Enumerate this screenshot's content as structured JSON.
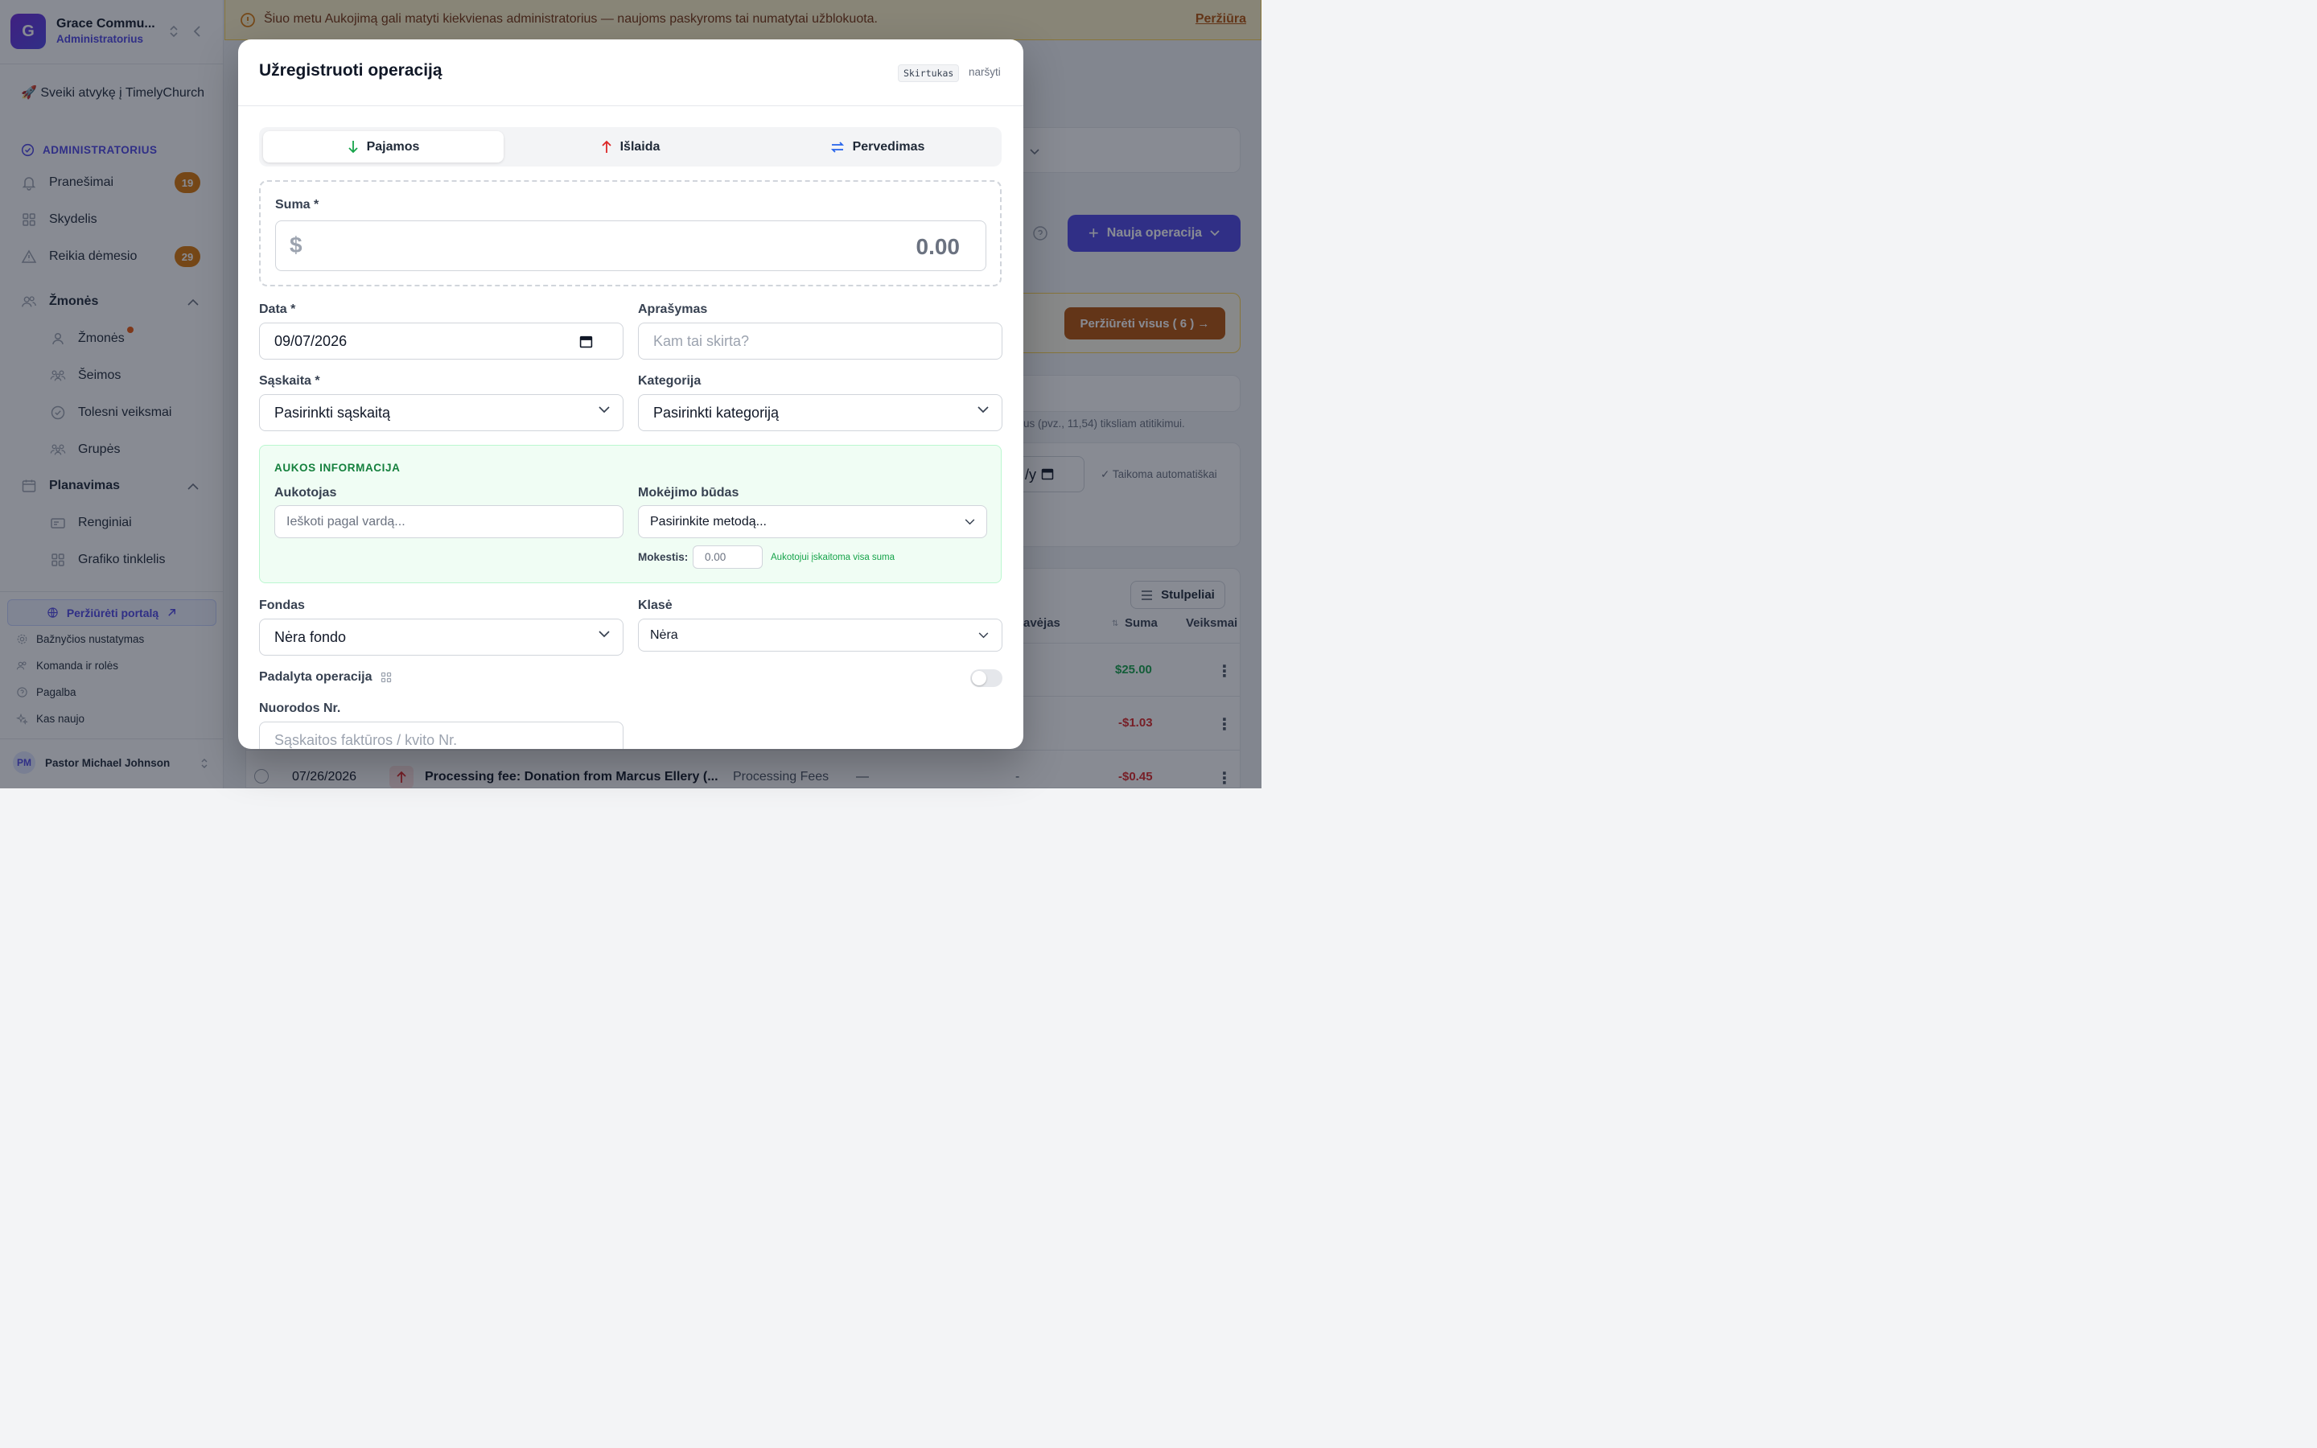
{
  "sidebar": {
    "org_initial": "G",
    "org_name": "Grace Commu...",
    "org_role": "Administratorius",
    "welcome": "🚀 Sveiki atvykę į TimelyChurch",
    "admin_label": "ADMINISTRATORIUS",
    "notifications": {
      "label": "Pranešimai",
      "count": "19"
    },
    "dashboard": {
      "label": "Skydelis"
    },
    "attention": {
      "label": "Reikia dėmesio",
      "count": "29"
    },
    "people_group": {
      "label": "Žmonės"
    },
    "people": {
      "label": "Žmonės"
    },
    "families": {
      "label": "Šeimos"
    },
    "followups": {
      "label": "Tolesni veiksmai"
    },
    "groups": {
      "label": "Grupės"
    },
    "planning_group": {
      "label": "Planavimas"
    },
    "events": {
      "label": "Renginiai"
    },
    "schedule_grid": {
      "label": "Grafiko tinklelis"
    },
    "portal_button": "Peržiūrėti portalą",
    "church_settings": "Bažnyčios nustatymas",
    "team_roles": "Komanda ir rolės",
    "help": "Pagalba",
    "whats_new": "Kas naujo",
    "user": {
      "initials": "PM",
      "name": "Pastor Michael Johnson"
    }
  },
  "banner": {
    "text": "Šiuo metu Aukojimą gali matyti kiekvienas administratorius — naujoms paskyroms tai numatytai užblokuota.",
    "link": "Peržiūra"
  },
  "background": {
    "new_operation": "Nauja operacija",
    "view_all": "Peržiūrėti visus ( 6 ) →",
    "hint_text": "us (pvz., 11,54) tiksliam atitikimui.",
    "date_placeholder": "/y",
    "applied_auto": "✓ Taikoma automatiškai",
    "columns_button": "Stulpeliai",
    "col_payer": "avėjas",
    "col_amount": "Suma",
    "col_actions": "Veiksmai",
    "rows": [
      {
        "amount": "$25.00"
      },
      {
        "amount": "-$1.03"
      },
      {
        "date": "07/26/2026",
        "description": "Processing fee: Donation from Marcus Ellery (...",
        "category": "Processing Fees",
        "payer": "—",
        "dash": "-",
        "amount": "-$0.45"
      }
    ]
  },
  "modal": {
    "title": "Užregistruoti operaciją",
    "kbd": "Skirtukas",
    "kbd_hint": "naršyti",
    "tabs": {
      "income": "Pajamos",
      "expense": "Išlaida",
      "transfer": "Pervedimas"
    },
    "amount": {
      "label": "Suma *",
      "currency": "$",
      "value": "0.00"
    },
    "date": {
      "label": "Data *",
      "value": "09/07/2026"
    },
    "description": {
      "label": "Aprašymas",
      "placeholder": "Kam tai skirta?"
    },
    "account": {
      "label": "Sąskaita *",
      "value": "Pasirinkti sąskaitą"
    },
    "category": {
      "label": "Kategorija",
      "value": "Pasirinkti kategoriją"
    },
    "donor_section": {
      "title": "AUKOS INFORMACIJA",
      "donor_label": "Aukotojas",
      "donor_placeholder": "Ieškoti pagal vardą...",
      "method_label": "Mokėjimo būdas",
      "method_value": "Pasirinkite metodą...",
      "fee_label": "Mokestis:",
      "fee_value": "0.00",
      "fee_note": "Aukotojui įskaitoma visa suma"
    },
    "fund": {
      "label": "Fondas",
      "value": "Nėra fondo"
    },
    "class": {
      "label": "Klasė",
      "value": "Nėra"
    },
    "split": {
      "label": "Padalyta operacija",
      "enabled": false
    },
    "reference": {
      "label": "Nuorodos Nr.",
      "placeholder": "Sąskaitos faktūros / kvito Nr."
    }
  },
  "colors": {
    "brand": "#4f46e5",
    "warning": "#d97706",
    "income_green": "#16a34a",
    "expense_red": "#dc2626",
    "transfer_blue": "#2563eb"
  }
}
